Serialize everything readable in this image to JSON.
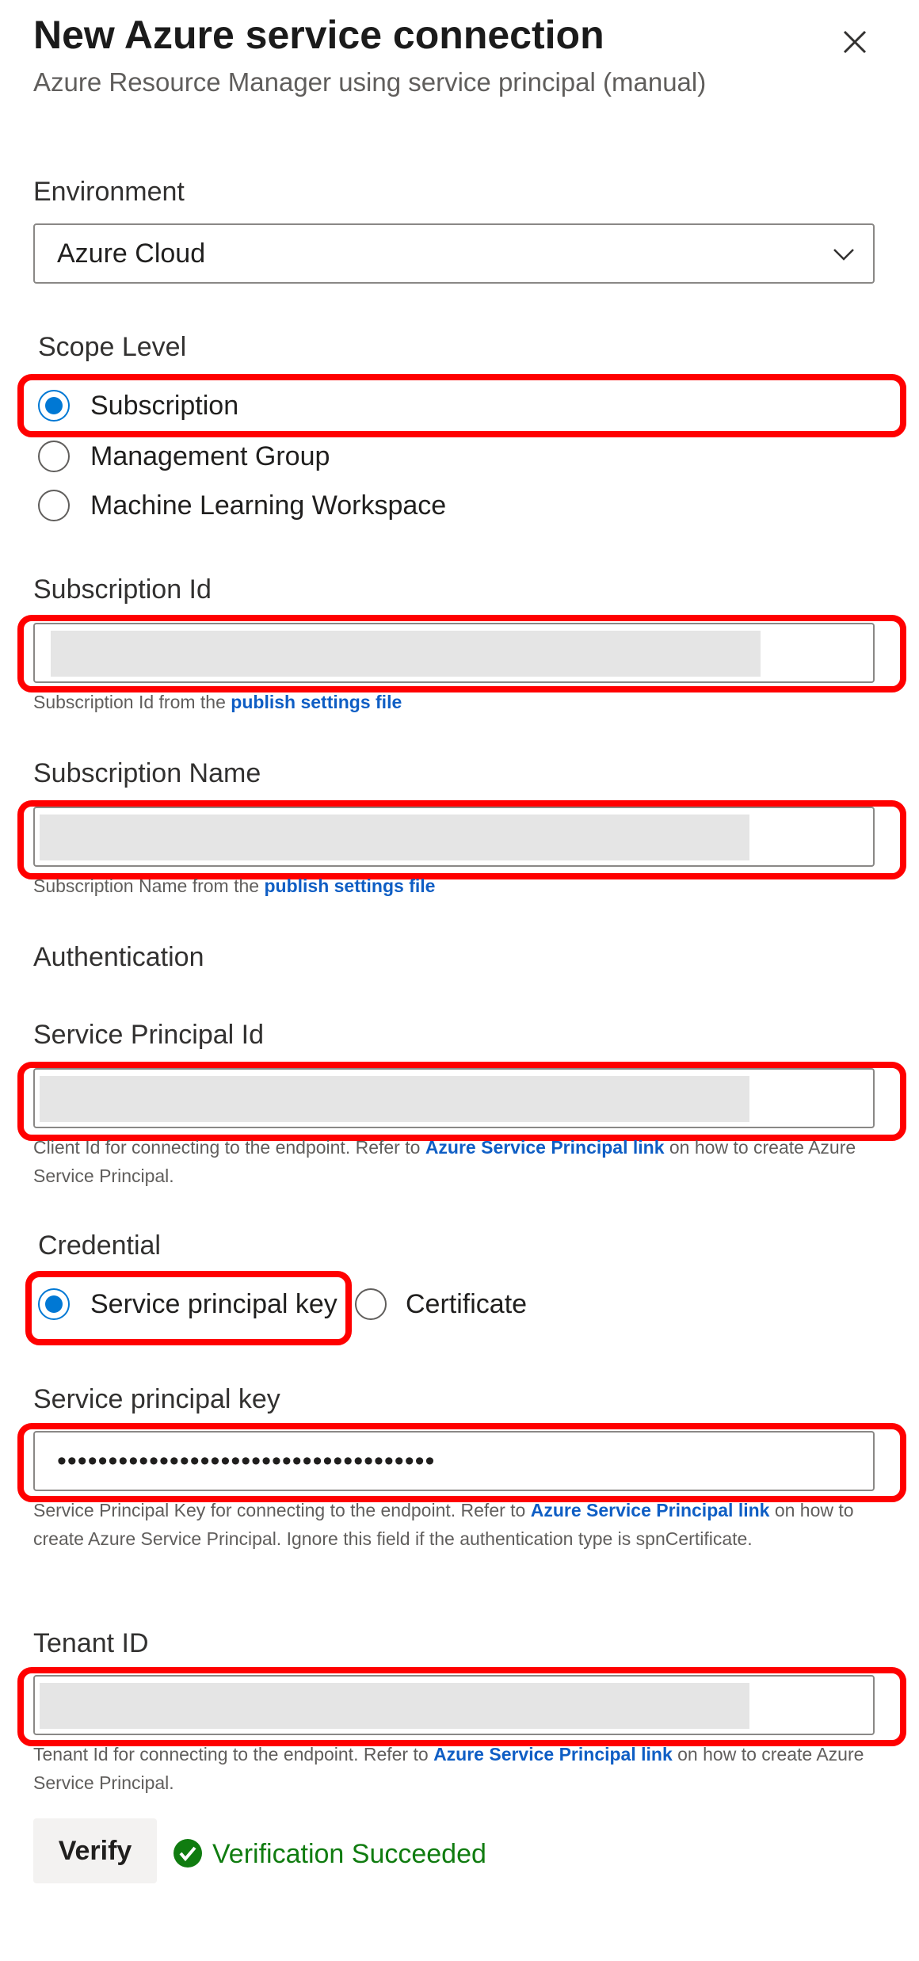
{
  "header": {
    "title": "New Azure service connection",
    "subtitle": "Azure Resource Manager using service principal (manual)"
  },
  "environment": {
    "label": "Environment",
    "selected": "Azure Cloud"
  },
  "scope_level": {
    "label": "Scope Level",
    "options": [
      {
        "label": "Subscription",
        "checked": true
      },
      {
        "label": "Management Group",
        "checked": false
      },
      {
        "label": "Machine Learning Workspace",
        "checked": false
      }
    ]
  },
  "subscription_id": {
    "label": "Subscription Id",
    "help_prefix": "Subscription Id from the",
    "help_link": "publish settings file"
  },
  "subscription_name": {
    "label": "Subscription Name",
    "help_prefix": "Subscription Name from the",
    "help_link": "publish settings file"
  },
  "authentication": {
    "label": "Authentication"
  },
  "service_principal_id": {
    "label": "Service Principal Id",
    "help_prefix": "Client Id for connecting to the endpoint. Refer to",
    "help_link": "Azure Service Principal link",
    "help_suffix": "on how to create Azure Service Principal."
  },
  "credential": {
    "label": "Credential",
    "options": [
      {
        "label": "Service principal key",
        "checked": true
      },
      {
        "label": "Certificate",
        "checked": false
      }
    ]
  },
  "service_principal_key": {
    "label": "Service principal key",
    "value": "•••••••••••••••••••••••••••••••••••••",
    "help_prefix": "Service Principal Key for connecting to the endpoint. Refer to",
    "help_link": "Azure Service Principal link",
    "help_suffix": "on how to create Azure Service Principal. Ignore this field if the authentication type is spnCertificate."
  },
  "tenant_id": {
    "label": "Tenant ID",
    "help_prefix": "Tenant Id for connecting to the endpoint. Refer to",
    "help_link": "Azure Service Principal link",
    "help_suffix": "on how to create Azure Service Principal."
  },
  "verify": {
    "button_label": "Verify",
    "status": "Verification Succeeded"
  },
  "colors": {
    "accent": "#0078d4",
    "success": "#107c10",
    "highlight": "#ff0000",
    "link": "#0f5ec4"
  },
  "icons": {
    "close": "close-icon",
    "chevron": "chevron-down-icon",
    "success": "check-circle-icon"
  }
}
